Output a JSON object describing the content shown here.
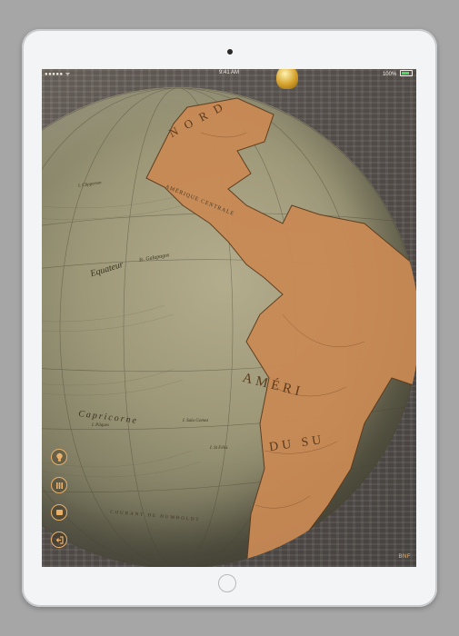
{
  "statusbar": {
    "signal": "●●●●● ᯤ",
    "time": "9:41 AM",
    "battery_label": "100%"
  },
  "globe": {
    "labels": {
      "nord": "N O R D",
      "centrale": "AMÉRIQUE CENTRALE",
      "equateur": "Equateur",
      "capricorne": "Capricorne",
      "amerique": "AMÉRI",
      "du_sud": "DU SU",
      "galapagos": "Is. Galapagos",
      "clipperton": "I. Clipperton",
      "sala_gomez": "I. Sala Gomez",
      "saint_felix": "I. St Félix",
      "paques": "I. Pâques",
      "courant": "COURANT DE HUMBOLDT"
    }
  },
  "toolbar": {
    "buttons": [
      {
        "name": "lightbulb-button",
        "icon": "lightbulb-icon"
      },
      {
        "name": "layers-button",
        "icon": "layers-icon"
      },
      {
        "name": "flag-button",
        "icon": "flag-icon"
      },
      {
        "name": "exit-button",
        "icon": "exit-icon"
      }
    ]
  },
  "credit": "BNF",
  "colors": {
    "accent": "#e8b06a",
    "land": "#c98a55",
    "ocean": "#9d9878"
  }
}
